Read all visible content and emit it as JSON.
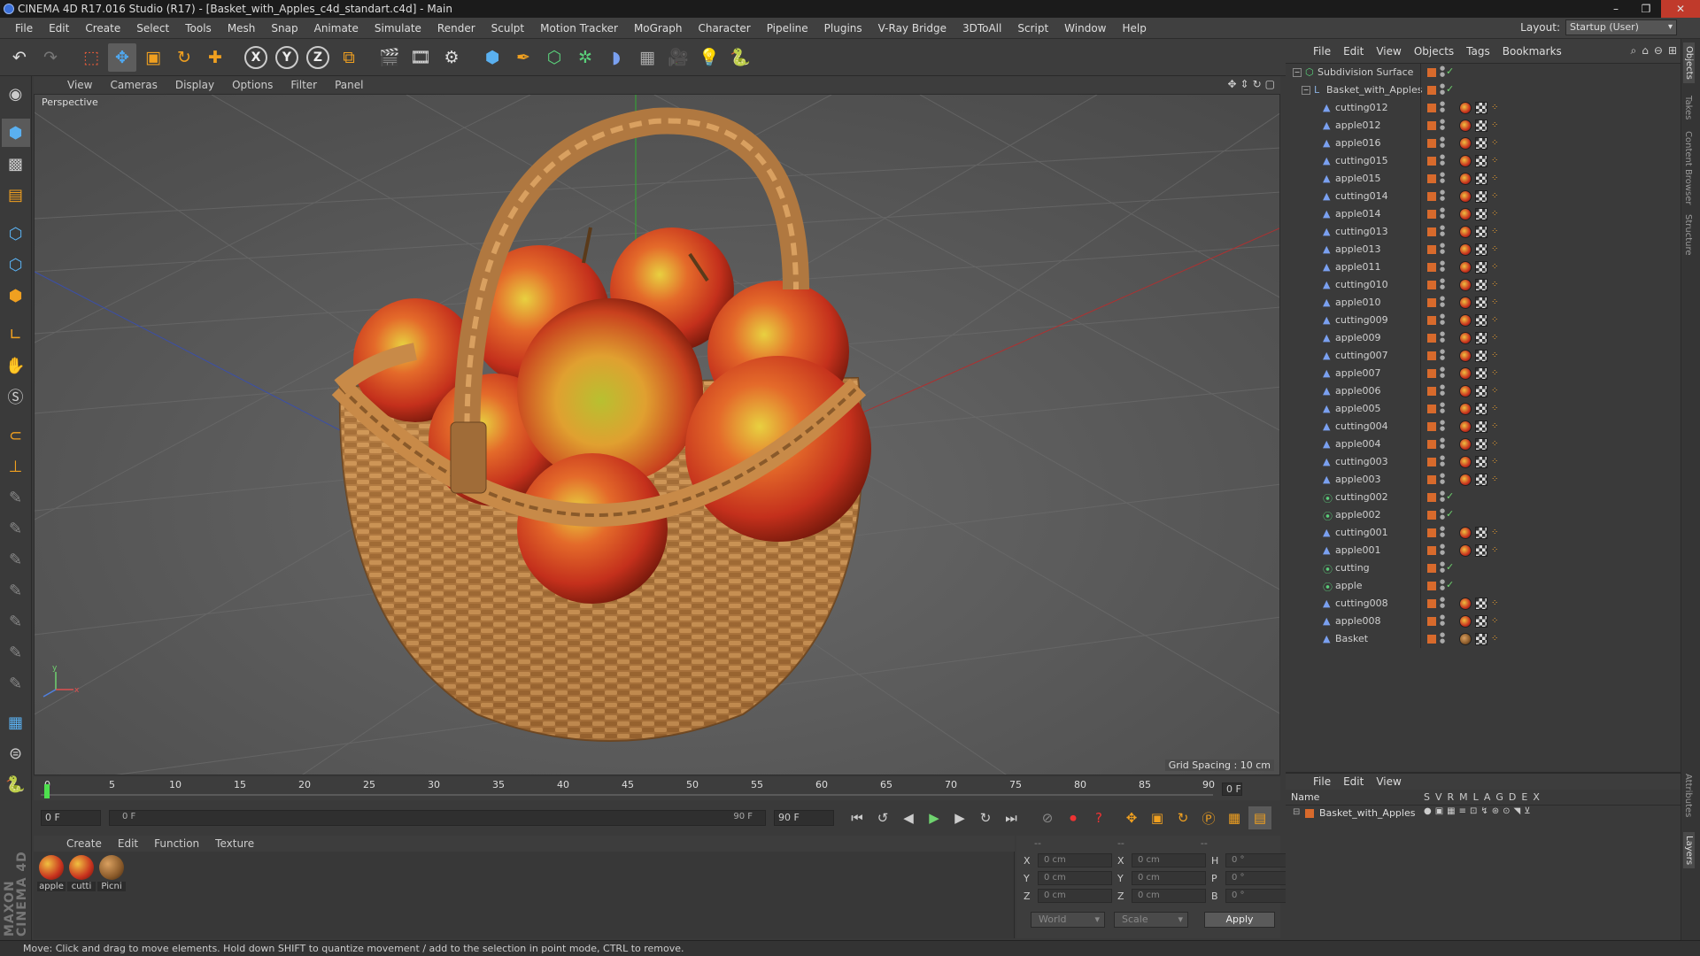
{
  "window": {
    "title": "CINEMA 4D R17.016 Studio (R17) - [Basket_with_Apples_c4d_standart.c4d] - Main",
    "controls": [
      "–",
      "❐",
      "✕"
    ]
  },
  "menubar": [
    "File",
    "Edit",
    "Create",
    "Select",
    "Tools",
    "Mesh",
    "Snap",
    "Animate",
    "Simulate",
    "Render",
    "Sculpt",
    "Motion Tracker",
    "MoGraph",
    "Character",
    "Pipeline",
    "Plugins",
    "V-Ray Bridge",
    "3DToAll",
    "Script",
    "Window",
    "Help"
  ],
  "layout": {
    "label": "Layout:",
    "value": "Startup (User)"
  },
  "toolbar": {
    "axis": [
      "X",
      "Y",
      "Z"
    ]
  },
  "viewport": {
    "menu": [
      "View",
      "Cameras",
      "Display",
      "Options",
      "Filter",
      "Panel"
    ],
    "label": "Perspective",
    "grid_spacing": "Grid Spacing : 10 cm"
  },
  "timeline": {
    "ticks": [
      "0",
      "5",
      "10",
      "15",
      "20",
      "25",
      "30",
      "35",
      "40",
      "45",
      "50",
      "55",
      "60",
      "65",
      "70",
      "75",
      "80",
      "85",
      "90"
    ],
    "current_frame": "0 F",
    "start_frame": "0 F",
    "range_start": "0 F",
    "range_end": "90 F",
    "end_frame": "90 F"
  },
  "materials": {
    "menu": [
      "Create",
      "Edit",
      "Function",
      "Texture"
    ],
    "items": [
      {
        "label": "apple",
        "color": "#c8321e"
      },
      {
        "label": "cutti",
        "color": "#c8321e"
      },
      {
        "label": "Picni",
        "color": "#a0683a"
      }
    ]
  },
  "coords": {
    "headers": [
      "--",
      "--",
      "--"
    ],
    "rows": [
      {
        "a": "X",
        "v1": "0 cm",
        "b": "X",
        "v2": "0 cm",
        "c": "H",
        "v3": "0 °"
      },
      {
        "a": "Y",
        "v1": "0 cm",
        "b": "Y",
        "v2": "0 cm",
        "c": "P",
        "v3": "0 °"
      },
      {
        "a": "Z",
        "v1": "0 cm",
        "b": "Z",
        "v2": "0 cm",
        "c": "B",
        "v3": "0 °"
      }
    ],
    "mode1": "World",
    "mode2": "Scale",
    "apply": "Apply"
  },
  "status": "Move: Click and drag to move elements. Hold down SHIFT to quantize movement / add to the selection in point mode, CTRL to remove.",
  "object_manager": {
    "menu": [
      "File",
      "Edit",
      "View",
      "Objects",
      "Tags",
      "Bookmarks"
    ],
    "objects": [
      {
        "name": "Subdivision Surface",
        "level": 0,
        "type": "subdiv",
        "tags": false
      },
      {
        "name": "Basket_with_Apples",
        "level": 1,
        "type": "null",
        "tags": false
      },
      {
        "name": "cutting012",
        "level": 2,
        "type": "poly",
        "tags": true
      },
      {
        "name": "apple012",
        "level": 2,
        "type": "poly",
        "tags": true
      },
      {
        "name": "apple016",
        "level": 2,
        "type": "poly",
        "tags": true
      },
      {
        "name": "cutting015",
        "level": 2,
        "type": "poly",
        "tags": true
      },
      {
        "name": "apple015",
        "level": 2,
        "type": "poly",
        "tags": true
      },
      {
        "name": "cutting014",
        "level": 2,
        "type": "poly",
        "tags": true
      },
      {
        "name": "apple014",
        "level": 2,
        "type": "poly",
        "tags": true
      },
      {
        "name": "cutting013",
        "level": 2,
        "type": "poly",
        "tags": true
      },
      {
        "name": "apple013",
        "level": 2,
        "type": "poly",
        "tags": true
      },
      {
        "name": "apple011",
        "level": 2,
        "type": "poly",
        "tags": true
      },
      {
        "name": "cutting010",
        "level": 2,
        "type": "poly",
        "tags": true
      },
      {
        "name": "apple010",
        "level": 2,
        "type": "poly",
        "tags": true
      },
      {
        "name": "cutting009",
        "level": 2,
        "type": "poly",
        "tags": true
      },
      {
        "name": "apple009",
        "level": 2,
        "type": "poly",
        "tags": true
      },
      {
        "name": "cutting007",
        "level": 2,
        "type": "poly",
        "tags": true
      },
      {
        "name": "apple007",
        "level": 2,
        "type": "poly",
        "tags": true
      },
      {
        "name": "apple006",
        "level": 2,
        "type": "poly",
        "tags": true
      },
      {
        "name": "apple005",
        "level": 2,
        "type": "poly",
        "tags": true
      },
      {
        "name": "cutting004",
        "level": 2,
        "type": "poly",
        "tags": true
      },
      {
        "name": "apple004",
        "level": 2,
        "type": "poly",
        "tags": true
      },
      {
        "name": "cutting003",
        "level": 2,
        "type": "poly",
        "tags": true
      },
      {
        "name": "apple003",
        "level": 2,
        "type": "poly",
        "tags": true
      },
      {
        "name": "cutting002",
        "level": 2,
        "type": "inst",
        "tags": false
      },
      {
        "name": "apple002",
        "level": 2,
        "type": "inst",
        "tags": false
      },
      {
        "name": "cutting001",
        "level": 2,
        "type": "poly",
        "tags": true
      },
      {
        "name": "apple001",
        "level": 2,
        "type": "poly",
        "tags": true
      },
      {
        "name": "cutting",
        "level": 2,
        "type": "inst",
        "tags": false
      },
      {
        "name": "apple",
        "level": 2,
        "type": "inst",
        "tags": false
      },
      {
        "name": "cutting008",
        "level": 2,
        "type": "poly",
        "tags": true
      },
      {
        "name": "apple008",
        "level": 2,
        "type": "poly",
        "tags": true
      },
      {
        "name": "Basket",
        "level": 2,
        "type": "poly",
        "tags": true
      }
    ]
  },
  "layer_manager": {
    "menu": [
      "File",
      "Edit",
      "View"
    ],
    "name_header": "Name",
    "columns": [
      "S",
      "V",
      "R",
      "M",
      "L",
      "A",
      "G",
      "D",
      "E",
      "X"
    ],
    "layer": "Basket_with_Apples"
  },
  "side_tabs": [
    "Objects",
    "Takes",
    "Content Browser",
    "Structure"
  ],
  "side_tabs_lower": [
    "Attributes",
    "Layers"
  ]
}
